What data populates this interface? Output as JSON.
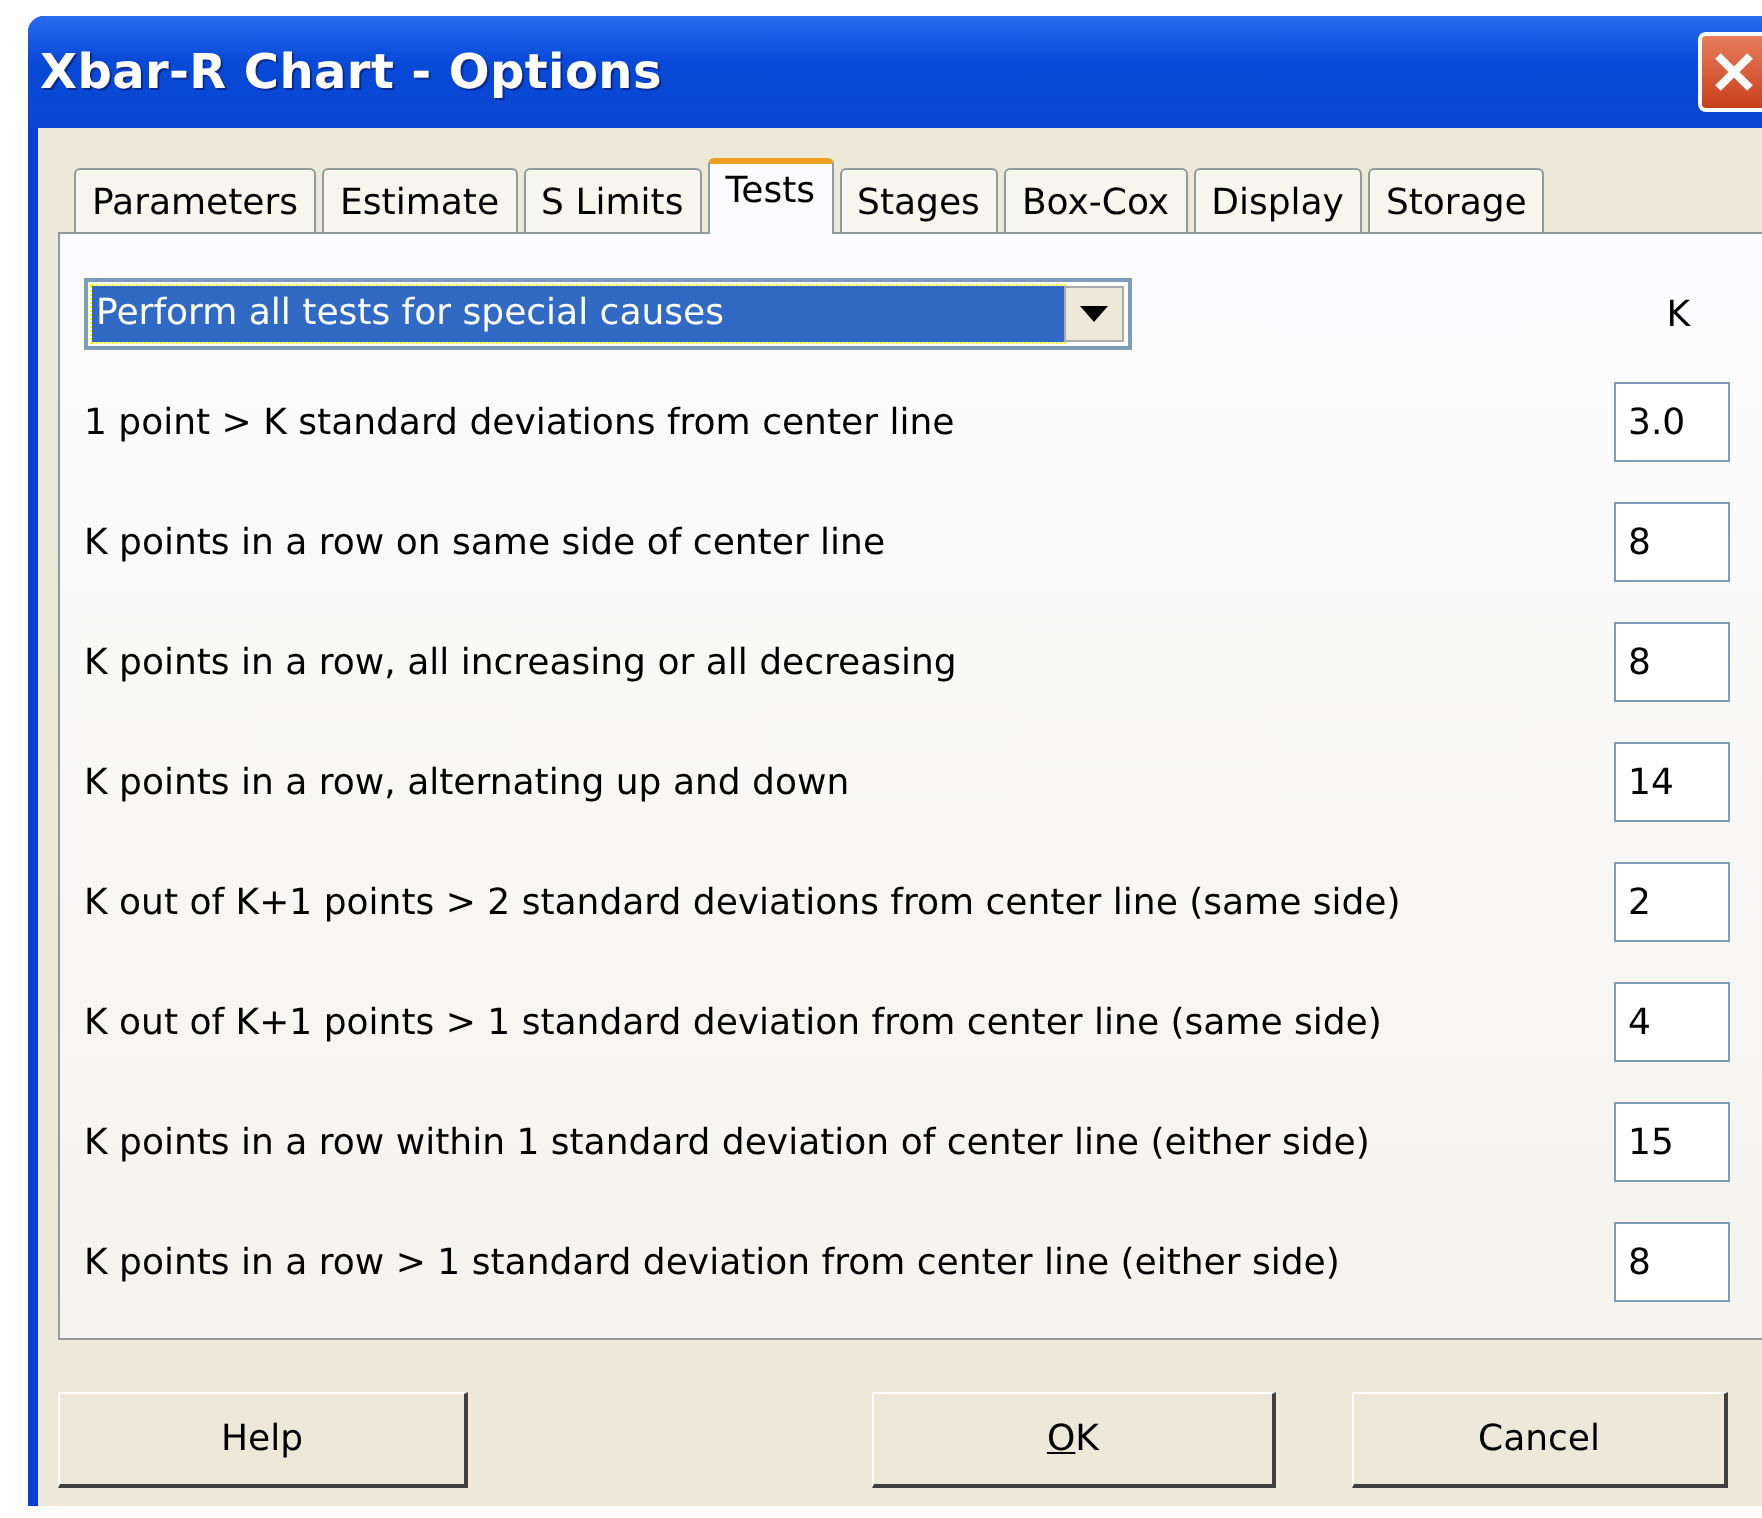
{
  "window": {
    "title": "Xbar-R Chart - Options"
  },
  "tabs": [
    {
      "label": "Parameters",
      "selected": false
    },
    {
      "label": "Estimate",
      "selected": false
    },
    {
      "label": "S Limits",
      "selected": false
    },
    {
      "label": "Tests",
      "selected": true
    },
    {
      "label": "Stages",
      "selected": false
    },
    {
      "label": "Box-Cox",
      "selected": false
    },
    {
      "label": "Display",
      "selected": false
    },
    {
      "label": "Storage",
      "selected": false
    }
  ],
  "test_selector": {
    "value": "Perform all tests for special causes",
    "focused": true
  },
  "k_heading": "K",
  "tests": [
    {
      "label": "1 point > K standard deviations from center line",
      "k": "3.0"
    },
    {
      "label": "K points in a row on same side of center line",
      "k": "8"
    },
    {
      "label": "K points in a row, all increasing or all decreasing",
      "k": "8"
    },
    {
      "label": "K points in a row, alternating up and down",
      "k": "14"
    },
    {
      "label": "K out of K+1 points > 2 standard deviations from center line (same side)",
      "k": "2"
    },
    {
      "label": "K out of K+1 points > 1 standard deviation from center line (same side)",
      "k": "4"
    },
    {
      "label": "K points in a row within 1 standard deviation of center line (either side)",
      "k": "15"
    },
    {
      "label": "K points in a row > 1 standard deviation from center line (either side)",
      "k": "8"
    }
  ],
  "buttons": [
    {
      "label": "Help",
      "underline_first": false
    },
    {
      "label": "OK",
      "underline_first": true
    },
    {
      "label": "Cancel",
      "underline_first": false
    }
  ]
}
